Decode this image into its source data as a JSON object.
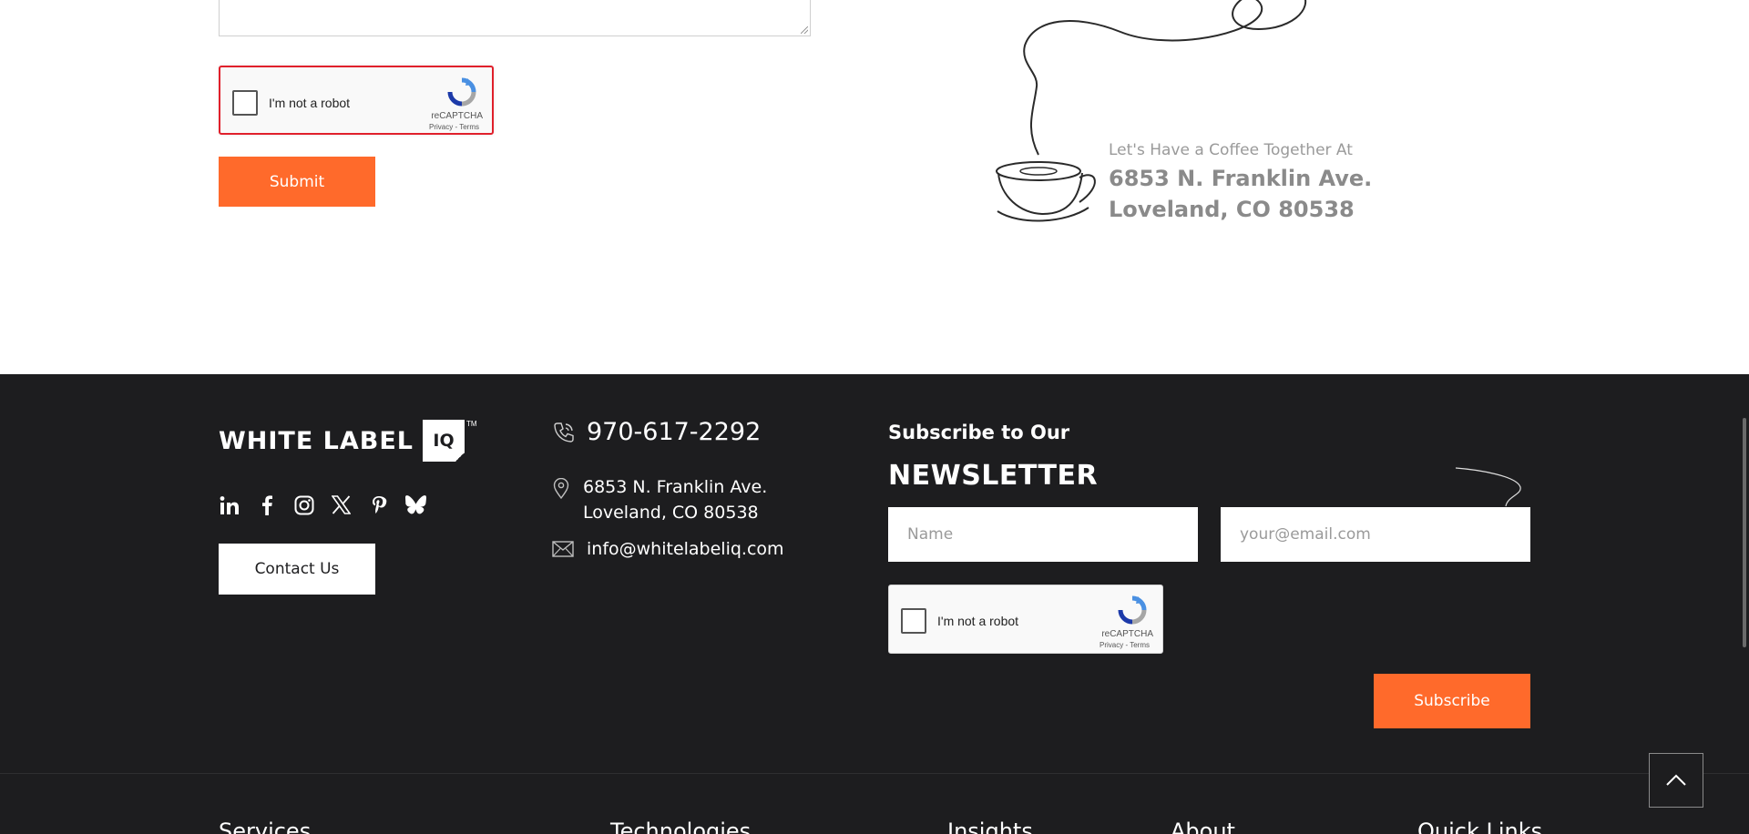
{
  "form": {
    "recaptcha": {
      "label": "I'm not a robot",
      "brand": "reCAPTCHA",
      "links": "Privacy - Terms"
    },
    "submit_label": "Submit"
  },
  "coffee": {
    "tagline": "Let's Have a Coffee Together At",
    "address_line1": "6853 N. Franklin Ave.",
    "address_line2": "Loveland, CO 80538"
  },
  "footer": {
    "logo": {
      "text": "WHITE LABEL",
      "box": "IQ",
      "tm": "TM"
    },
    "socials": [
      "linkedin-icon",
      "facebook-icon",
      "instagram-icon",
      "x-icon",
      "pinterest-icon",
      "bluesky-icon"
    ],
    "contact_button": "Contact Us",
    "phone": "970-617-2292",
    "address_line1": "6853 N. Franklin Ave.",
    "address_line2": "Loveland, CO 80538",
    "email": "info@whitelabeliq.com",
    "newsletter": {
      "pretitle": "Subscribe to Our",
      "title": "NEWSLETTER",
      "name_placeholder": "Name",
      "email_placeholder": "your@email.com",
      "recaptcha": {
        "label": "I'm not a robot",
        "brand": "reCAPTCHA",
        "links": "Privacy - Terms"
      },
      "subscribe_label": "Subscribe"
    },
    "nav_headings": [
      "Services",
      "Technologies",
      "Insights",
      "About",
      "Quick Links"
    ]
  },
  "colors": {
    "accent": "#ff6a2b",
    "footer_bg": "#1d1d1f",
    "error": "#e0202b"
  }
}
